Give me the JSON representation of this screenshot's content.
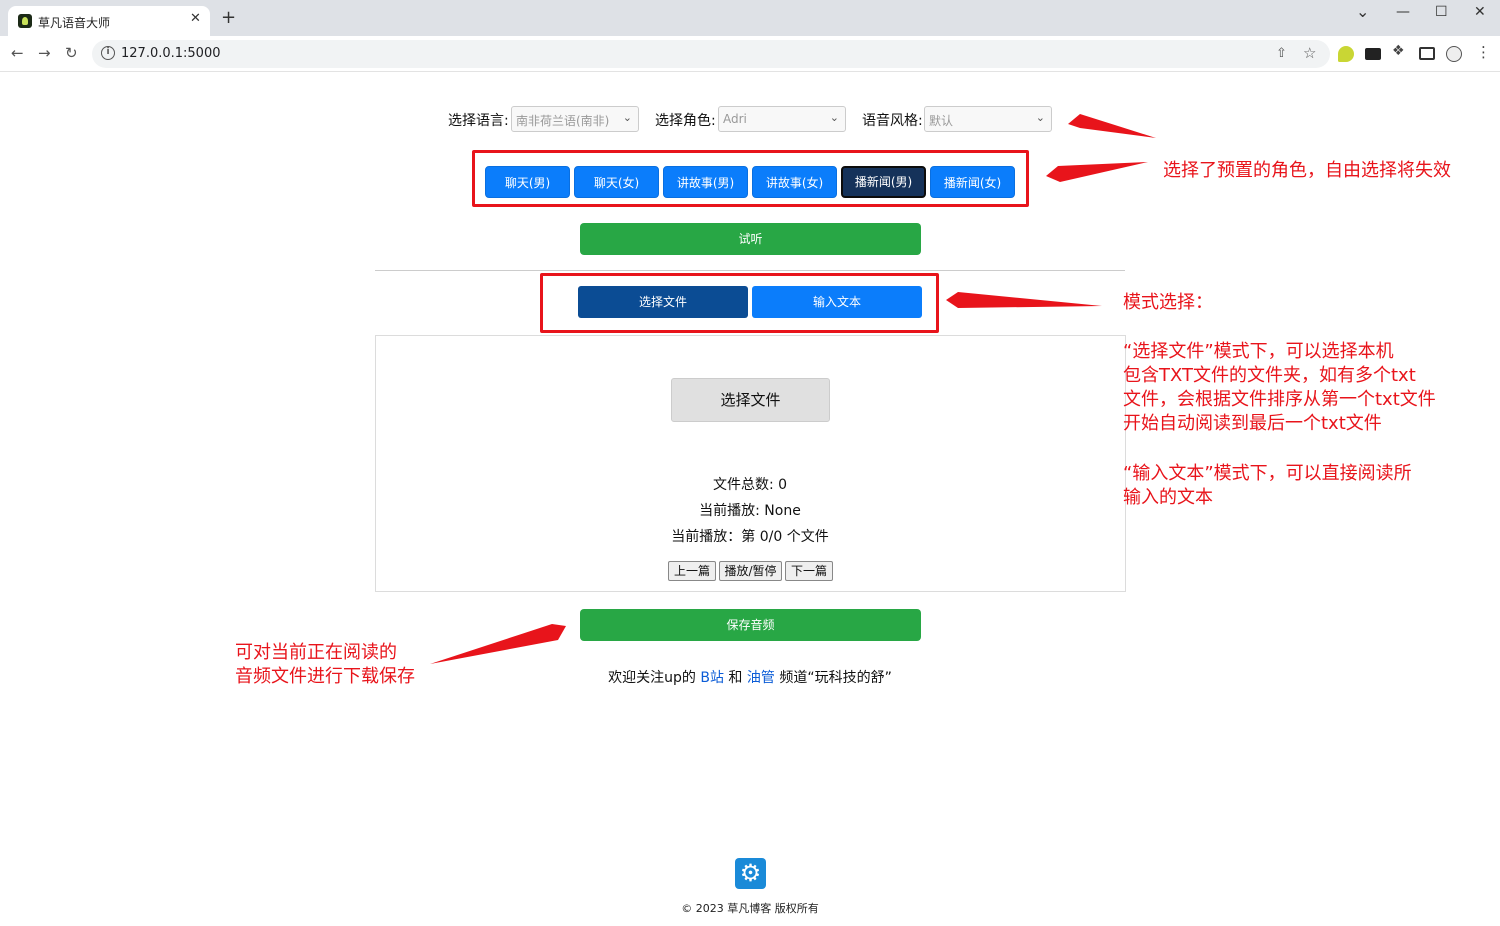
{
  "browser": {
    "tab_title": "草凡语音大师",
    "tab_close": "✕",
    "new_tab": "+",
    "url": "127.0.0.1:5000",
    "window_controls": {
      "collapse": "⌄",
      "minimize": "—",
      "maximize": "☐",
      "close": "✕"
    }
  },
  "controls": {
    "language_label": "选择语言:",
    "language_value": "南非荷兰语(南非)",
    "role_label": "选择角色:",
    "role_value": "Adri",
    "style_label": "语音风格:",
    "style_value": "默认"
  },
  "presets": [
    {
      "label": "聊天(男)",
      "active": false
    },
    {
      "label": "聊天(女)",
      "active": false
    },
    {
      "label": "讲故事(男)",
      "active": false
    },
    {
      "label": "讲故事(女)",
      "active": false
    },
    {
      "label": "播新闻(男)",
      "active": true
    },
    {
      "label": "播新闻(女)",
      "active": false
    }
  ],
  "listen_button": "试听",
  "modes": {
    "file": "选择文件",
    "text": "输入文本"
  },
  "file_panel": {
    "choose_file": "选择文件",
    "total_files": "文件总数: 0",
    "current_playing": "当前播放: None",
    "current_index": "当前播放：第 0/0 个文件",
    "prev": "上一篇",
    "play_pause": "播放/暂停",
    "next": "下一篇"
  },
  "save_button": "保存音频",
  "footer_note": {
    "before": "欢迎关注up的 ",
    "bilibili": "B站",
    "and": " 和 ",
    "youtube": "油管",
    "after": " 频道“玩科技的舒”"
  },
  "copyright": "© 2023 草凡博客 版权所有",
  "annotations": {
    "presets_note": "选择了预置的角色，自由选择将失效",
    "mode_title": "模式选择：",
    "mode_file_desc": [
      "“选择文件”模式下，可以选择本机",
      "包含TXT文件的文件夹，如有多个txt",
      "文件，会根据文件排序从第一个txt文件",
      "开始自动阅读到最后一个txt文件"
    ],
    "mode_text_desc": [
      "“输入文本”模式下，可以直接阅读所",
      "输入的文本"
    ],
    "save_note": [
      "可对当前正在阅读的",
      "音频文件进行下载保存"
    ]
  },
  "colors": {
    "primary_blue": "#0b7dfb",
    "active_navy": "#15325a",
    "green": "#28a745",
    "annotation_red": "#e8141b"
  }
}
